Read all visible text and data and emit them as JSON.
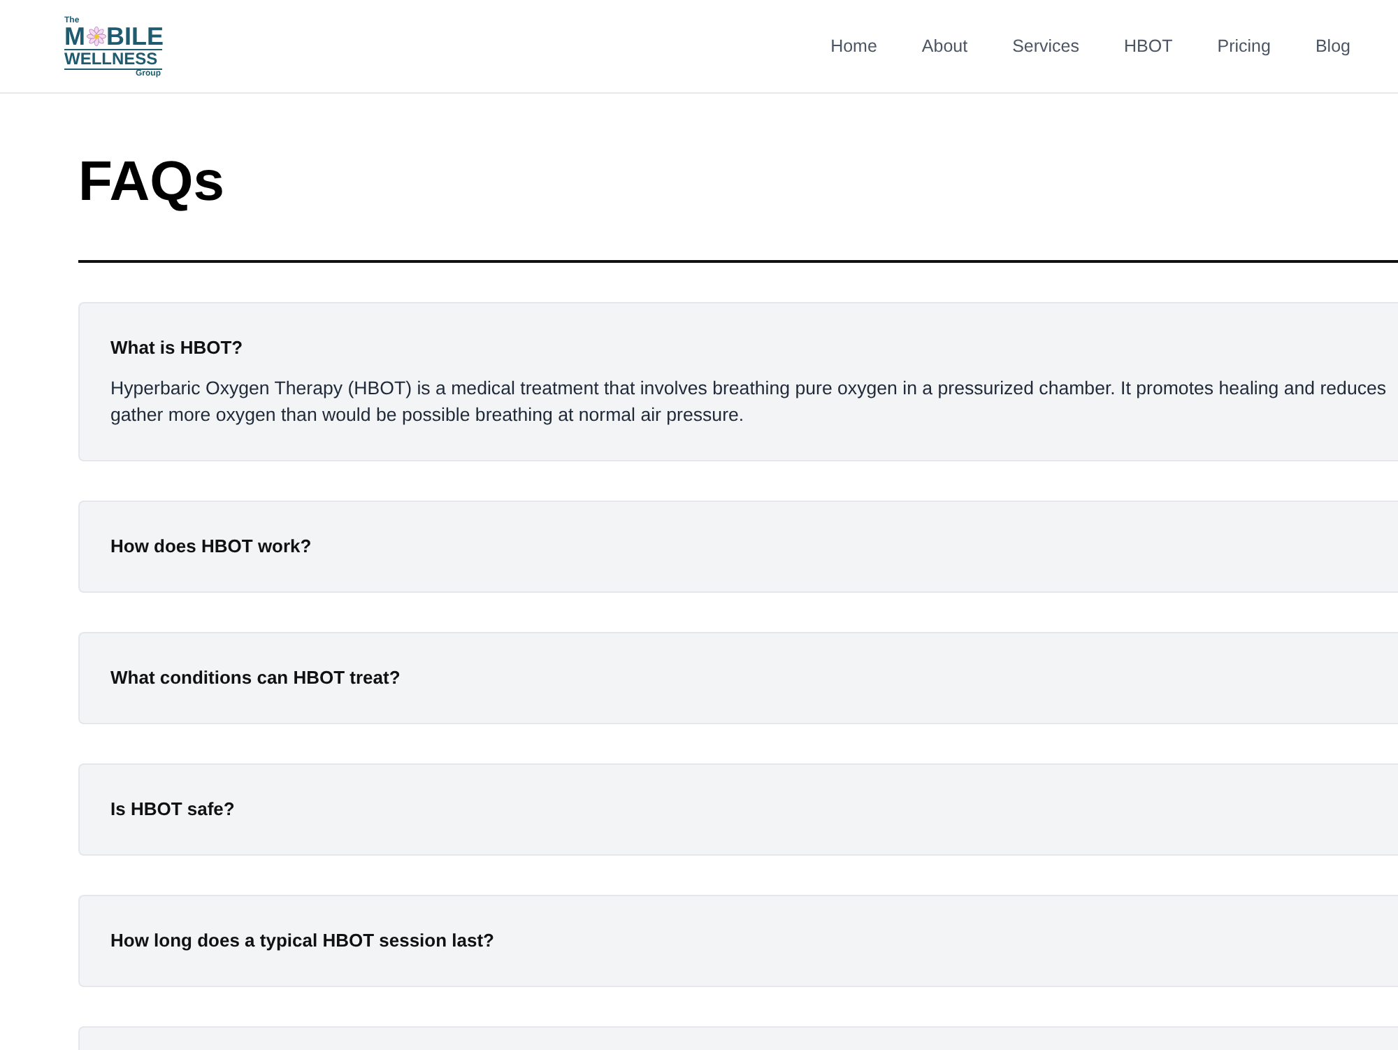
{
  "header": {
    "logo": {
      "prefix": "The",
      "word_start": "M",
      "word_end": "BILE",
      "second_line": "WELLNESS",
      "suffix": "Group"
    },
    "nav": [
      "Home",
      "About",
      "Services",
      "HBOT",
      "Pricing",
      "Blog"
    ]
  },
  "page_title": "FAQs",
  "faqs": [
    {
      "question": "What is HBOT?",
      "expanded": true,
      "answer_lines": [
        "Hyperbaric Oxygen Therapy (HBOT) is a medical treatment that involves breathing pure oxygen in a pressurized chamber. It promotes healing and reduces",
        "gather more oxygen than would be possible breathing at normal air pressure."
      ]
    },
    {
      "question": "How does HBOT work?",
      "expanded": false
    },
    {
      "question": "What conditions can HBOT treat?",
      "expanded": false
    },
    {
      "question": "Is HBOT safe?",
      "expanded": false
    },
    {
      "question": "How long does a typical HBOT session last?",
      "expanded": false
    },
    {
      "expanded": false
    }
  ]
}
